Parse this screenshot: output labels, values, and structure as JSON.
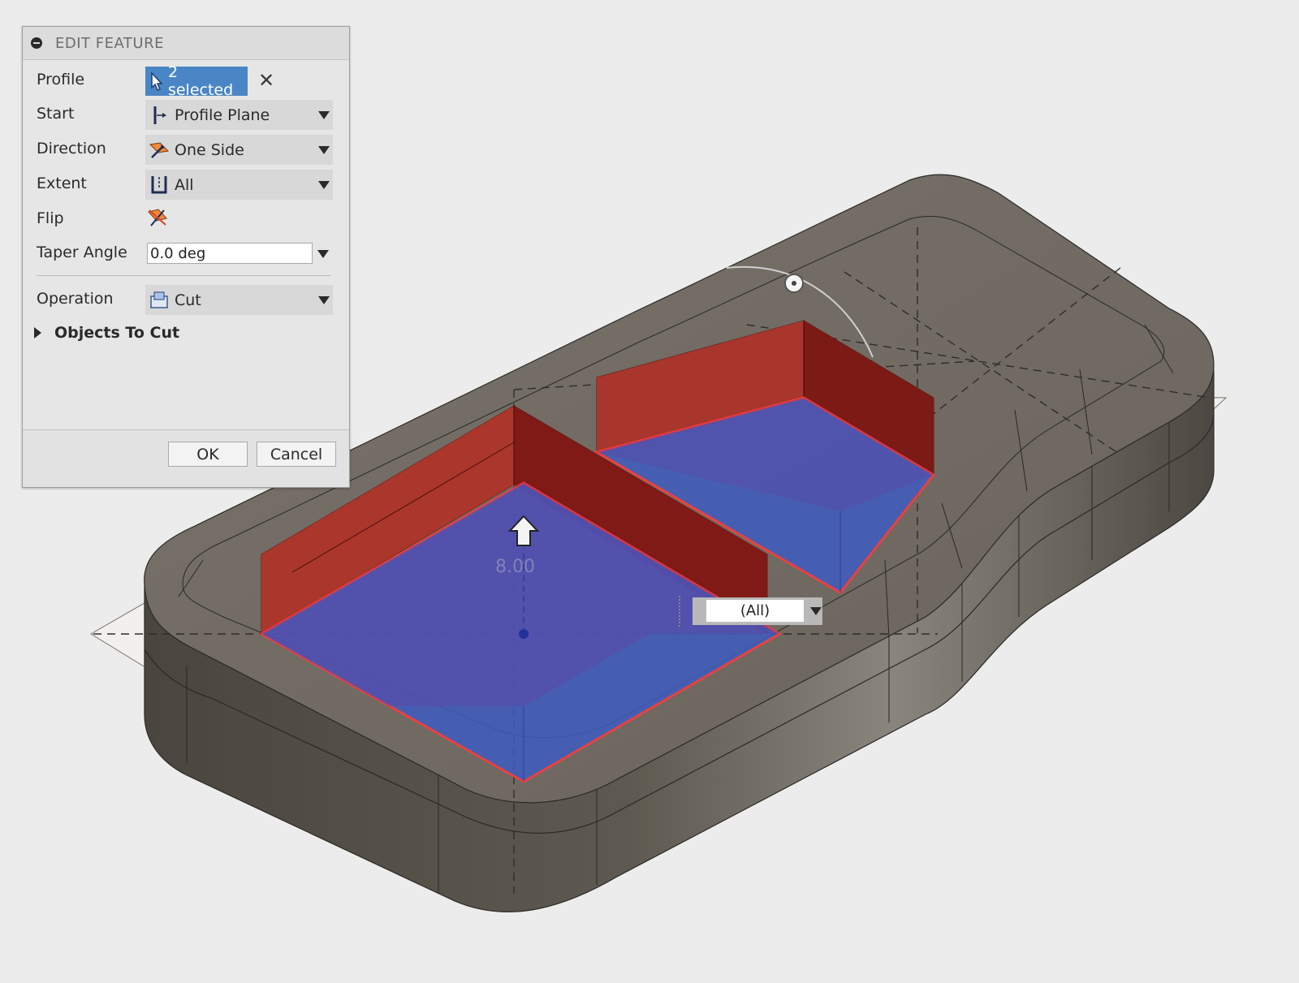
{
  "dialog": {
    "title": "EDIT FEATURE",
    "profile": {
      "label": "Profile",
      "value": "2 selected"
    },
    "start": {
      "label": "Start",
      "value": "Profile Plane",
      "icon": "profile-plane-icon"
    },
    "direction": {
      "label": "Direction",
      "value": "One Side",
      "icon": "one-side-icon"
    },
    "extent": {
      "label": "Extent",
      "value": "All",
      "icon": "extent-all-icon"
    },
    "flip": {
      "label": "Flip",
      "icon": "flip-icon"
    },
    "taper": {
      "label": "Taper Angle",
      "value": "0.0 deg"
    },
    "operation": {
      "label": "Operation",
      "value": "Cut",
      "icon": "cut-icon"
    },
    "objects_to_cut": "Objects To Cut",
    "ok": "OK",
    "cancel": "Cancel"
  },
  "canvas": {
    "extent_dropdown": "(All)",
    "distance_label": "8.00",
    "colors": {
      "body": "#6b655d",
      "cut_region": "#a32a22",
      "profile_fill": "#4a5fc0",
      "profile_edge": "#ff3b3b",
      "accent": "#4a86c6"
    }
  }
}
